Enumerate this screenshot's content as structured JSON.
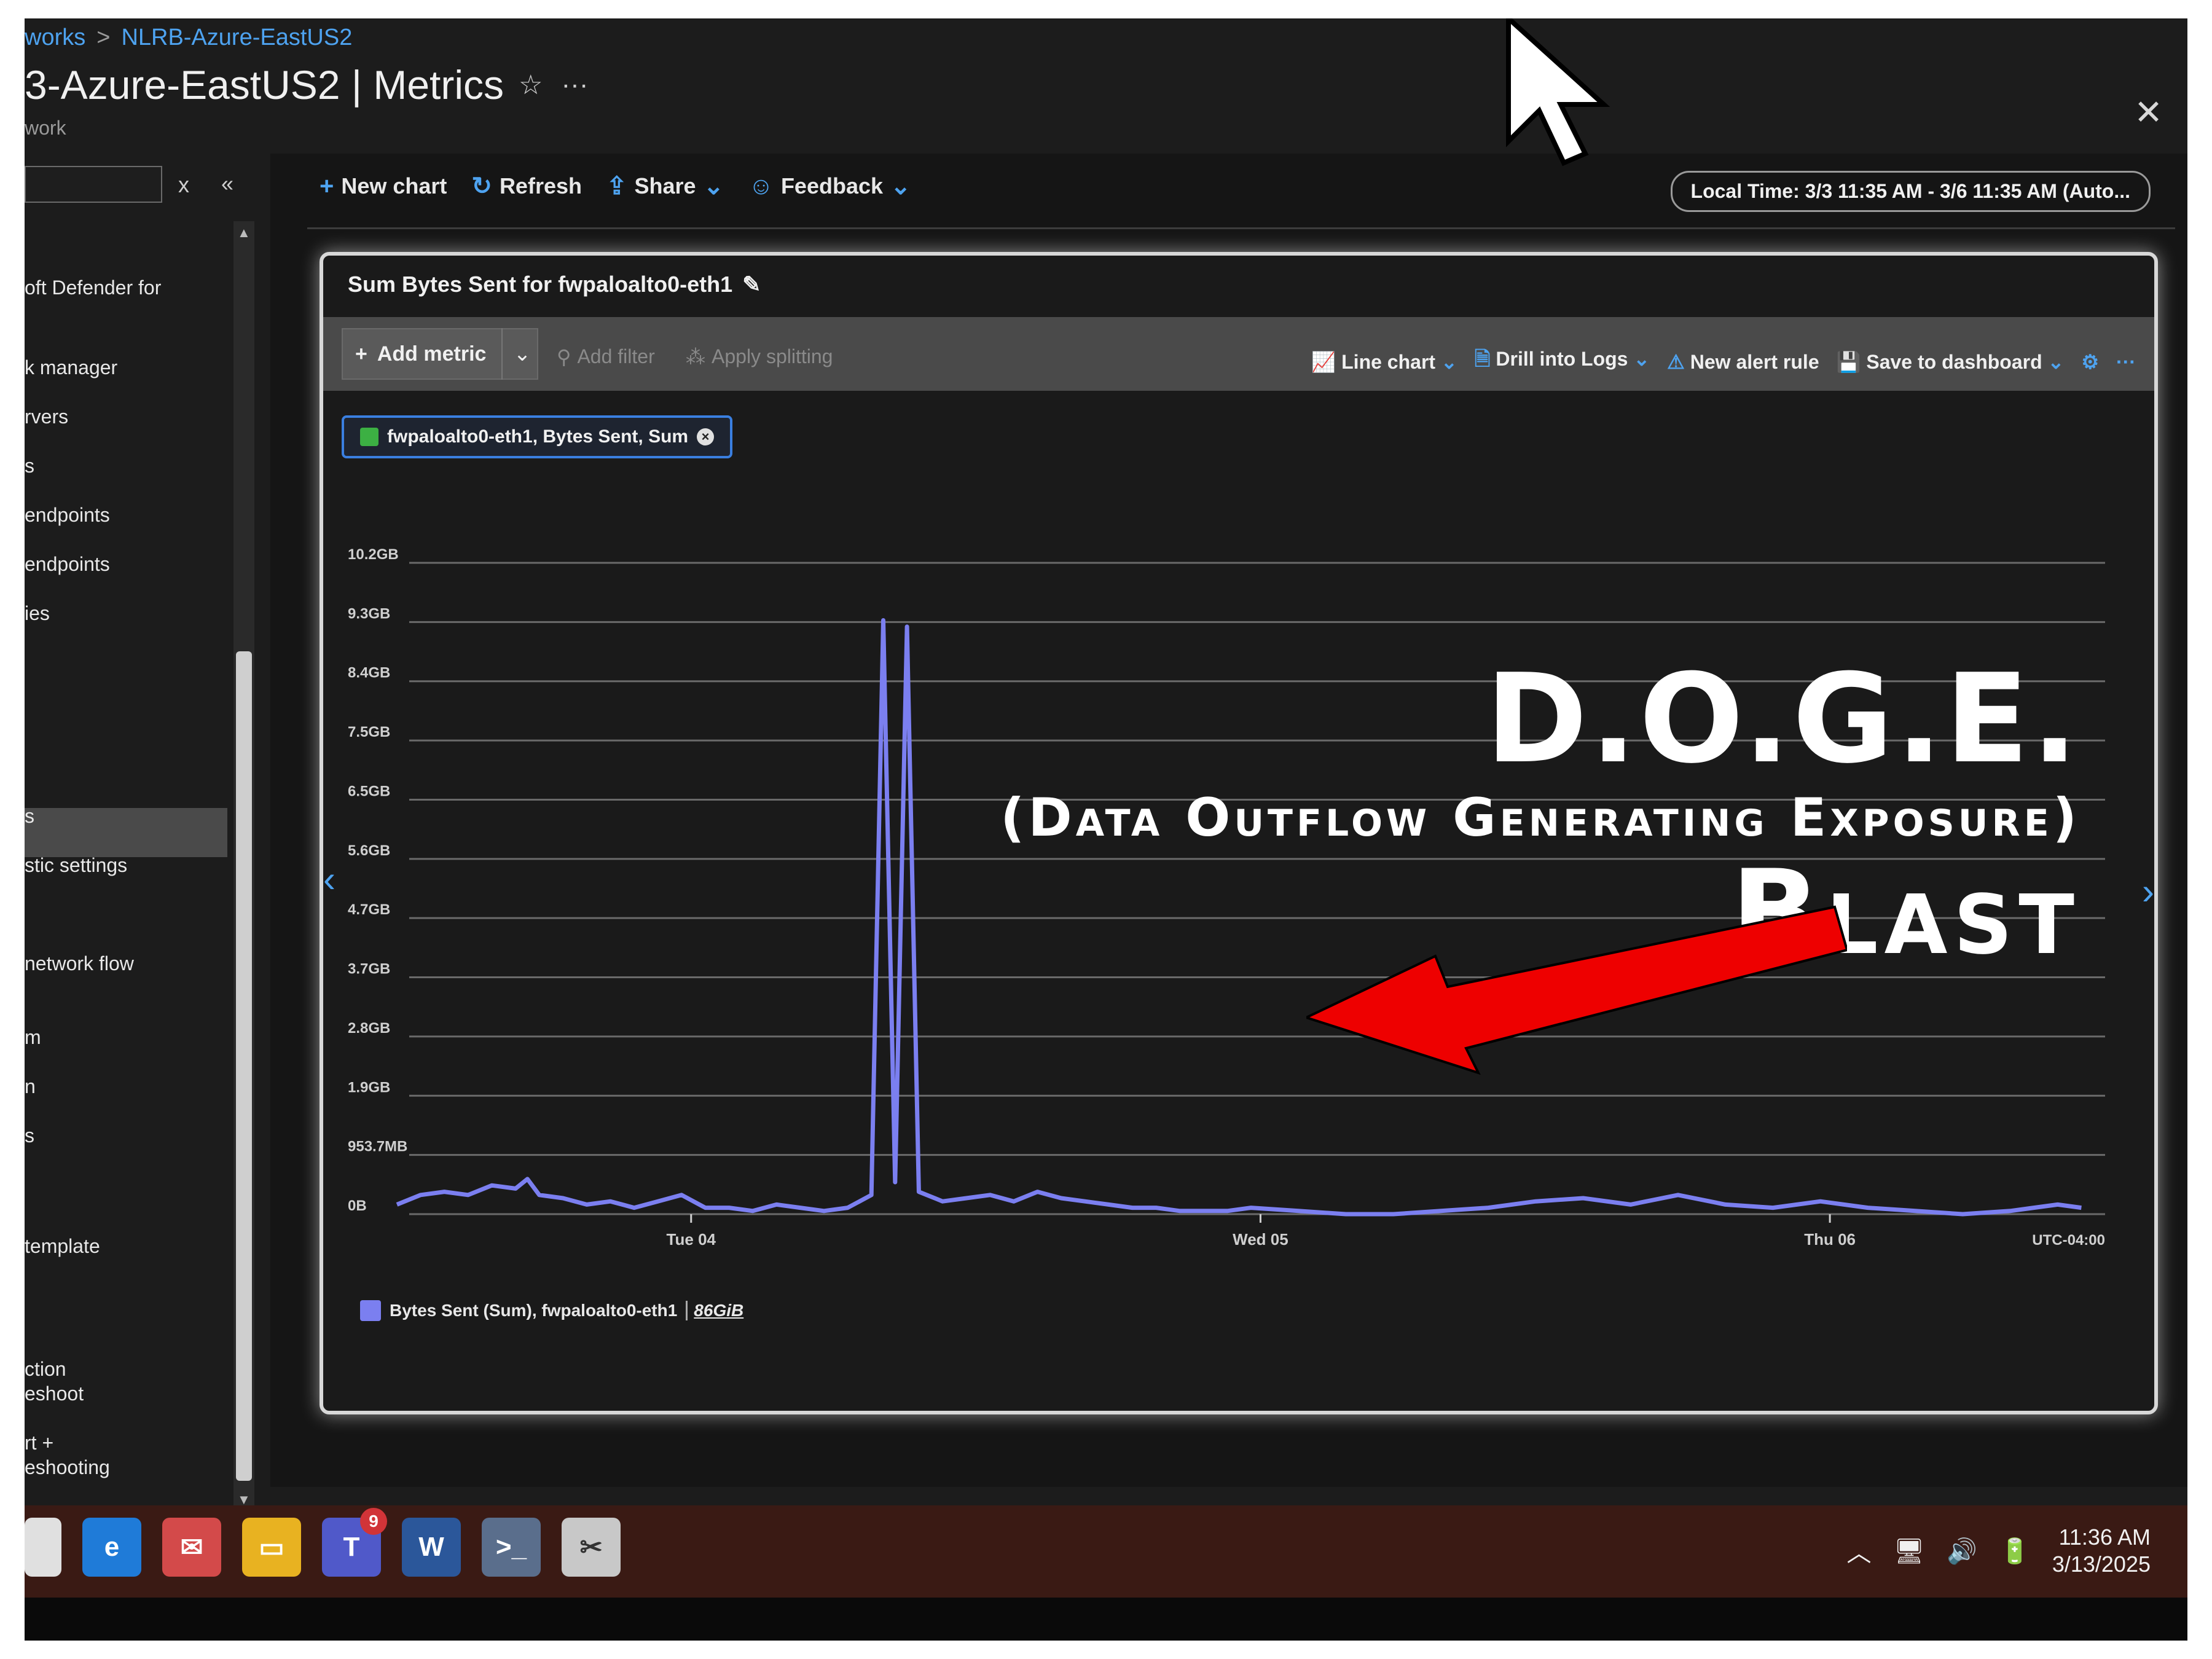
{
  "breadcrumb": {
    "items": [
      "works",
      "NLRB-Azure-EastUS2"
    ],
    "separator": ">"
  },
  "page": {
    "title": "3-Azure-EastUS2 | Metrics",
    "subtitle": "work",
    "star_icon": "☆",
    "more_icon": "···",
    "close_icon": "✕"
  },
  "sidebar": {
    "close_icon": "x",
    "collapse_icon": "«",
    "items": [
      {
        "label": "oft Defender for"
      },
      {
        "label": "k manager"
      },
      {
        "label": "rvers"
      },
      {
        "label": "s"
      },
      {
        "label": "endpoints"
      },
      {
        "label": "endpoints"
      },
      {
        "label": "ies"
      },
      {
        "label": "s"
      },
      {
        "label": "stic settings"
      },
      {
        "label": "network flow"
      },
      {
        "label": "m"
      },
      {
        "label": "n"
      },
      {
        "label": "s"
      },
      {
        "label": "template"
      },
      {
        "label": "ction"
      },
      {
        "label": "eshoot"
      },
      {
        "label": "rt +"
      },
      {
        "label": "eshooting"
      }
    ]
  },
  "toolbar": {
    "new_chart": "New chart",
    "refresh": "Refresh",
    "share": "Share",
    "feedback": "Feedback",
    "time_range": "Local Time: 3/3 11:35 AM - 3/6 11:35 AM (Auto..."
  },
  "chart": {
    "title": "Sum Bytes Sent for fwpaloalto0-eth1",
    "add_metric": "Add metric",
    "add_filter": "Add filter",
    "apply_splitting": "Apply splitting",
    "line_chart": "Line chart",
    "drill_logs": "Drill into Logs",
    "new_alert": "New alert rule",
    "save_dashboard": "Save to dashboard",
    "more": "···",
    "pill_label": "fwpaloalto0-eth1, Bytes Sent, Sum",
    "legend_label": "Bytes Sent (Sum), fwpaloalto0-eth1",
    "legend_value": "86GiB"
  },
  "chart_data": {
    "type": "line",
    "y_ticks": [
      "10.2GB",
      "9.3GB",
      "8.4GB",
      "7.5GB",
      "6.5GB",
      "5.6GB",
      "4.7GB",
      "3.7GB",
      "2.8GB",
      "1.9GB",
      "953.7MB",
      "0B"
    ],
    "x_ticks": [
      "Tue 04",
      "Wed 05",
      "Thu 06"
    ],
    "x_tick_positions_hours": [
      12.4,
      36.4,
      60.4
    ],
    "timezone": "UTC-04:00",
    "x_range_hours": [
      0,
      72
    ],
    "ylim_gb": [
      0,
      10.2
    ],
    "series": [
      {
        "name": "Bytes Sent (Sum), fwpaloalto0-eth1",
        "color": "#7b7ff0",
        "x_hours": [
          0,
          1,
          2,
          3,
          4,
          5,
          5.5,
          6,
          7,
          8,
          9,
          10,
          11,
          12,
          13,
          14,
          15,
          16,
          17,
          18,
          19,
          20,
          20.5,
          21,
          21.5,
          22,
          23,
          24,
          25,
          26,
          27,
          28,
          29,
          30,
          31,
          32,
          33,
          34,
          35,
          36,
          38,
          40,
          42,
          44,
          46,
          48,
          50,
          52,
          54,
          56,
          58,
          60,
          62,
          64,
          66,
          68,
          70,
          71
        ],
        "values_gb": [
          0.15,
          0.3,
          0.35,
          0.3,
          0.45,
          0.4,
          0.55,
          0.3,
          0.25,
          0.15,
          0.2,
          0.1,
          0.2,
          0.3,
          0.1,
          0.1,
          0.05,
          0.15,
          0.1,
          0.05,
          0.1,
          0.3,
          9.3,
          0.5,
          9.2,
          0.35,
          0.2,
          0.25,
          0.3,
          0.2,
          0.35,
          0.25,
          0.2,
          0.15,
          0.1,
          0.1,
          0.05,
          0.05,
          0.05,
          0.1,
          0.05,
          0.0,
          0.0,
          0.05,
          0.1,
          0.2,
          0.25,
          0.15,
          0.3,
          0.15,
          0.1,
          0.2,
          0.1,
          0.05,
          0.0,
          0.05,
          0.15,
          0.1
        ]
      }
    ]
  },
  "overlay": {
    "title": "D.O.G.E.",
    "subtitle": "(Data Outflow Generating Exposure)",
    "blast": "Blast",
    "arrow_color": "#ee0000"
  },
  "taskbar": {
    "teams_badge": "9",
    "time": "11:36 AM",
    "date": "3/13/2025"
  }
}
